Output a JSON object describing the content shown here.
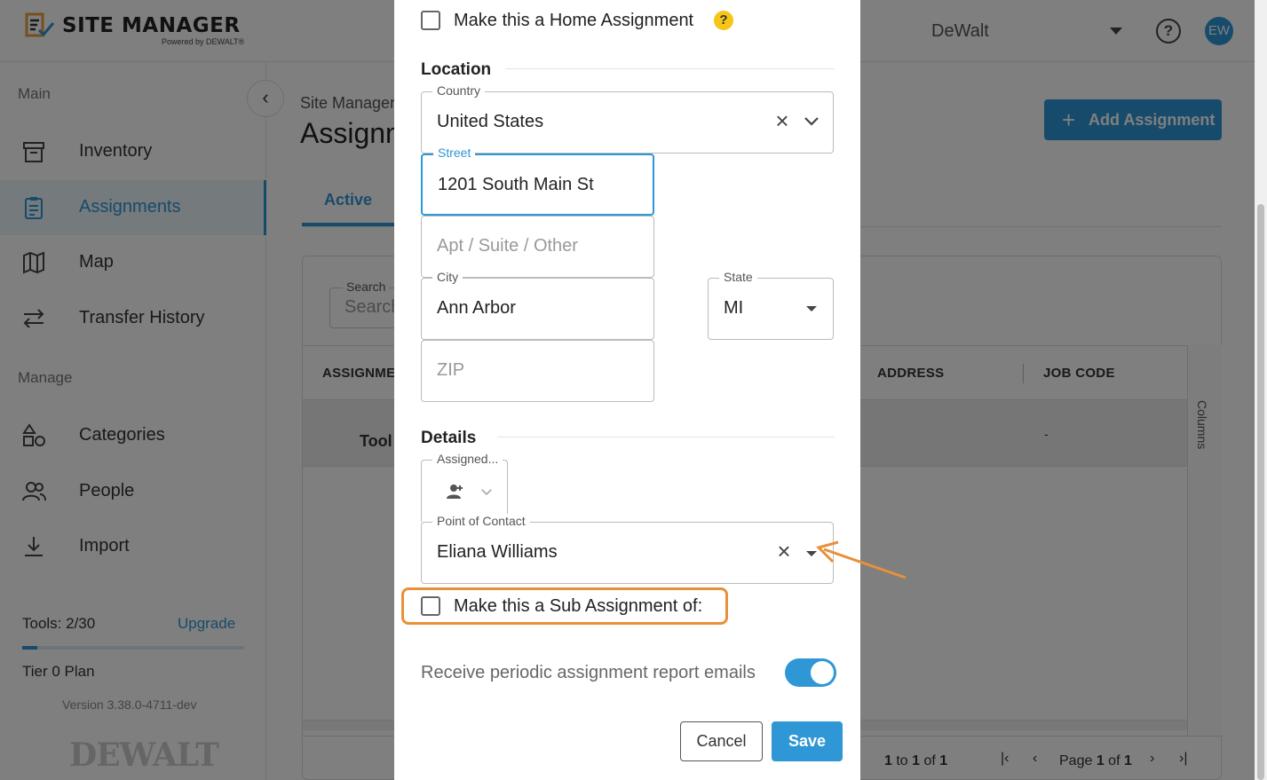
{
  "header": {
    "logo_title": "SITE MANAGER",
    "logo_sub": "Powered by DEWALT®",
    "company": "DeWalt",
    "avatar_initials": "EW",
    "help_glyph": "?"
  },
  "sidebar": {
    "main_label": "Main",
    "manage_label": "Manage",
    "items": [
      {
        "label": "Inventory",
        "icon": "archive-box-icon"
      },
      {
        "label": "Assignments",
        "icon": "clipboard-icon",
        "active": true
      },
      {
        "label": "Map",
        "icon": "map-icon"
      },
      {
        "label": "Transfer History",
        "icon": "transfer-arrows-icon"
      },
      {
        "label": "Categories",
        "icon": "shapes-icon"
      },
      {
        "label": "People",
        "icon": "people-icon"
      },
      {
        "label": "Import",
        "icon": "download-icon"
      }
    ],
    "tools_count": "Tools: 2/30",
    "tools_fraction": 0.067,
    "upgrade": "Upgrade",
    "plan": "Tier 0 Plan",
    "version": "Version 3.38.0-4711-dev",
    "footer_brand": "DEWALT"
  },
  "main": {
    "breadcrumb": "Site Manager",
    "title": "Assignm",
    "add_button": "Add Assignment",
    "tab_active": "Active",
    "search_label": "Search",
    "search_placeholder": "Search",
    "columns": [
      "ASSIGNME",
      "ADDRESS",
      "JOB CODE"
    ],
    "row": {
      "name": "Tool",
      "job_code": "-"
    },
    "columns_button": "Columns",
    "pager": {
      "count_pre": "1",
      "count_mid": " to ",
      "count_end": "1",
      "count_of": " of ",
      "count_total": "1",
      "page_pre": "Page ",
      "page": "1",
      "page_of": " of ",
      "page_total": "1"
    }
  },
  "modal": {
    "home_assignment": "Make this a Home Assignment",
    "home_help": "?",
    "location_title": "Location",
    "country_label": "Country",
    "country_value": "United States",
    "street_label": "Street",
    "street_value": "1201 South Main St",
    "apt_placeholder": "Apt / Suite / Other",
    "city_label": "City",
    "city_value": "Ann Arbor",
    "state_label": "State",
    "state_value": "MI",
    "zip_placeholder": "ZIP",
    "details_title": "Details",
    "assigned_label": "Assigned...",
    "poc_label": "Point of Contact",
    "poc_value": "Eliana Williams",
    "sub_assignment": "Make this a Sub Assignment of:",
    "report_emails": "Receive periodic assignment report emails",
    "report_toggle_on": true,
    "cancel": "Cancel",
    "save": "Save"
  },
  "colors": {
    "accent": "#2f97d6",
    "highlight": "#e8903a",
    "help_badge": "#f5c518"
  }
}
